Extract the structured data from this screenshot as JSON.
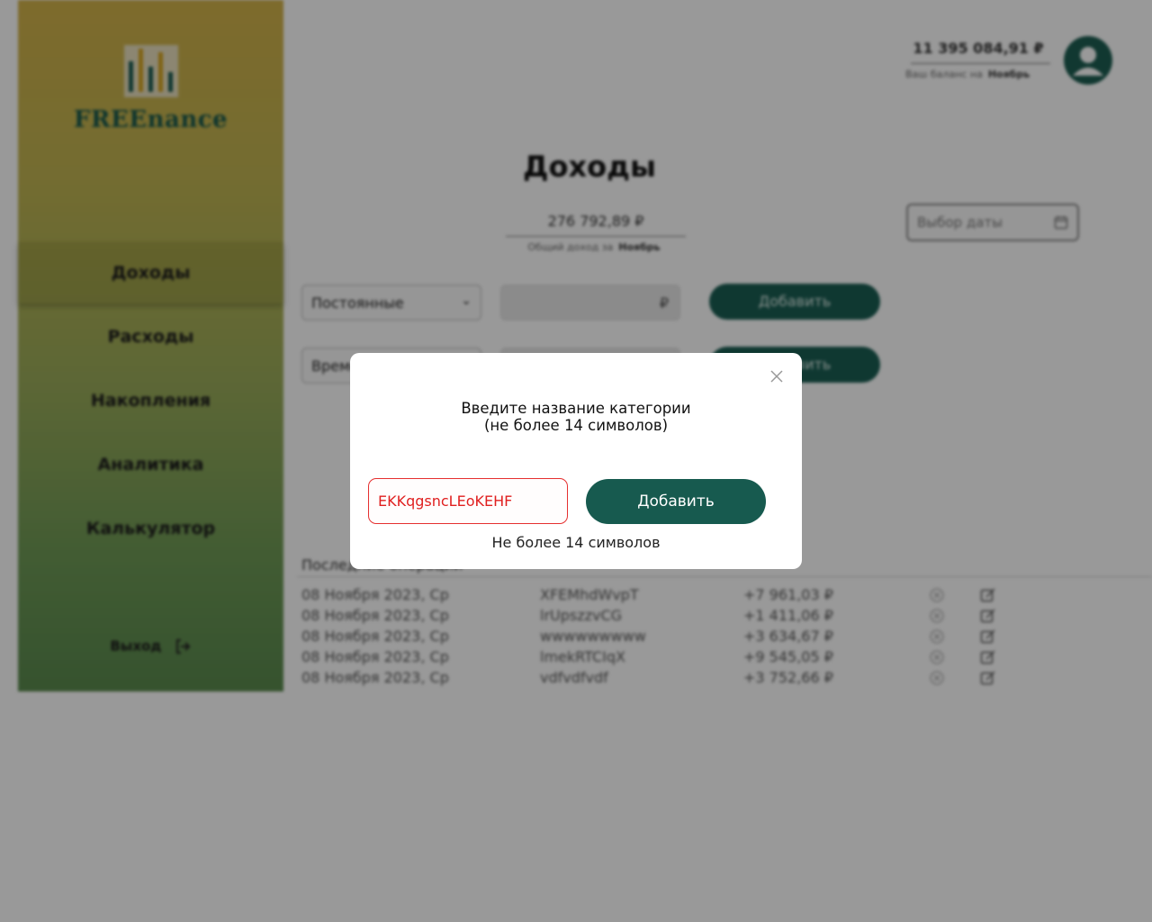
{
  "app": {
    "brand": "FREEnance",
    "logo_bars": [
      "#1d5e52",
      "#d6a41f",
      "#1d5e52",
      "#d6a41f",
      "#1d5e52"
    ]
  },
  "sidebar": {
    "items": [
      {
        "label": "Доходы",
        "active": true
      },
      {
        "label": "Расходы"
      },
      {
        "label": "Накопления"
      },
      {
        "label": "Аналитика"
      },
      {
        "label": "Калькулятор"
      }
    ],
    "logout_label": "Выход"
  },
  "header": {
    "balance_value": "11 395 084,91 ₽",
    "balance_caption": "Ваш баланс на",
    "balance_month": "Ноябрь"
  },
  "main": {
    "title": "Доходы",
    "total_value": "276 792,89 ₽",
    "total_caption": "Общий доход за",
    "total_month": "Ноябрь",
    "date_placeholder": "Выбор даты",
    "rows": [
      {
        "select": "Постоянные",
        "currency": "₽",
        "button": "Добавить"
      },
      {
        "select": "Временные",
        "currency": "₽",
        "button": "Добавить"
      }
    ]
  },
  "recent": {
    "title": "Последние операции",
    "items": [
      {
        "date": "08 Ноября 2023, Ср",
        "name": "XFEMhdWvpT",
        "amount": "+7 961,03 ₽"
      },
      {
        "date": "08 Ноября 2023, Ср",
        "name": "lrUpszzvCG",
        "amount": "+1 411,06 ₽"
      },
      {
        "date": "08 Ноября 2023, Ср",
        "name": "wwwwwwwww",
        "amount": "+3 634,67 ₽"
      },
      {
        "date": "08 Ноября 2023, Ср",
        "name": "lmekRTCIqX",
        "amount": "+9 545,05 ₽"
      },
      {
        "date": "08 Ноября 2023, Ср",
        "name": "vdfvdfvdf",
        "amount": "+3 752,66 ₽"
      }
    ]
  },
  "modal": {
    "heading_line1": "Введите название категории",
    "heading_line2": "(не более 14 символов)",
    "input_value": "EKKqgsncLEoKEHF",
    "submit_label": "Добавить",
    "error_text": "Не более 14 символов"
  },
  "colors": {
    "accent": "#175a4f",
    "error": "#e53030"
  }
}
